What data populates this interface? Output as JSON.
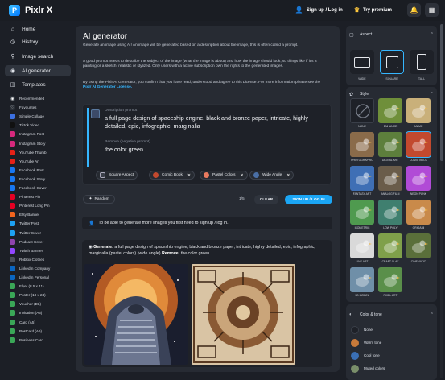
{
  "app": {
    "name": "Pixlr X"
  },
  "topbar": {
    "signup": "Sign up / Log in",
    "premium": "Try premium"
  },
  "sidebar": {
    "nav": [
      {
        "label": "Home",
        "icon": "home-icon"
      },
      {
        "label": "History",
        "icon": "history-icon"
      },
      {
        "label": "Image search",
        "icon": "search-icon"
      },
      {
        "label": "AI generator",
        "icon": "ai-icon"
      },
      {
        "label": "Templates",
        "icon": "templates-icon"
      }
    ],
    "templates": [
      {
        "label": "Recommended",
        "color": "#2a2f37"
      },
      {
        "label": "Favourites",
        "color": "#2a2f37"
      },
      {
        "label": "Simple Collage",
        "color": "#3b6fe0"
      },
      {
        "label": "Tiktok Video",
        "color": "#111111"
      },
      {
        "label": "Instagram Post",
        "color": "#d6297d"
      },
      {
        "label": "Instagram Story",
        "color": "#d6297d"
      },
      {
        "label": "YouTube Thumb",
        "color": "#e62117"
      },
      {
        "label": "YouTube Art",
        "color": "#e62117"
      },
      {
        "label": "Facebook Post",
        "color": "#1877f2"
      },
      {
        "label": "Facebook Story",
        "color": "#1877f2"
      },
      {
        "label": "Facebook Cover",
        "color": "#1877f2"
      },
      {
        "label": "Pinterest Pin",
        "color": "#e60023"
      },
      {
        "label": "Pinterest Long Pin",
        "color": "#e60023"
      },
      {
        "label": "Etsy Banner",
        "color": "#f1641e"
      },
      {
        "label": "Twitter Post",
        "color": "#1da1f2"
      },
      {
        "label": "Twitter Cover",
        "color": "#1da1f2"
      },
      {
        "label": "Podcast Cover",
        "color": "#8e44ad"
      },
      {
        "label": "Twitch Banner",
        "color": "#9146ff"
      },
      {
        "label": "Roblox Clothes",
        "color": "#4a4f59"
      },
      {
        "label": "LinkedIn Company",
        "color": "#0a66c2"
      },
      {
        "label": "LinkedIn Personal",
        "color": "#0a66c2"
      },
      {
        "label": "Flyer (8.5 x 11)",
        "color": "#3aa757"
      },
      {
        "label": "Poster (18 x 24)",
        "color": "#3aa757"
      },
      {
        "label": "Voucher (DL)",
        "color": "#3aa757"
      },
      {
        "label": "Invitation (A5)",
        "color": "#3aa757"
      },
      {
        "label": "Card (A5)",
        "color": "#3aa757"
      },
      {
        "label": "Postcard (A6)",
        "color": "#3aa757"
      },
      {
        "label": "Business Card",
        "color": "#3aa757"
      }
    ]
  },
  "main": {
    "title": "AI generator",
    "paragraphs": [
      "Generate an image using AI! An image will be generated based on a description about the image, this is often called a prompt.",
      "A good prompt needs to describe the subject of the image (what the image is about) and how the image should look, so things like if it's a painting or a sketch, realistic or stylized. Only users with a active subscription own the rights to the generated images.",
      "By using the Pixlr AI Generator, you confirm that you have read, understood and agree to this License. For more information please see the"
    ],
    "license_link": "Pixlr AI Generator License.",
    "prompt_label": "Description prompt",
    "prompt_text": "a full page design of spaceship engine, black and bronze paper, intricate, highly detailed, epic, infographic, marginalia",
    "negative_label": "Remove (negative prompt)",
    "negative_text": "the color green",
    "chips": [
      {
        "label": "Square Aspect",
        "color": "#3a3f49"
      },
      {
        "label": "Comic Book",
        "color": "#c2492e"
      },
      {
        "label": "Pastel Colors",
        "color": "#e87a5f"
      },
      {
        "label": "Wide Angle",
        "color": "#4a6fa5"
      }
    ],
    "random_label": "Random",
    "counter": "1/5",
    "clear_label": "CLEAR",
    "signup_label": "SIGN UP / LOG IN",
    "notice": "To be able to generate more images you first need to sign up / log in.",
    "generate_label": "Generate:",
    "generate_text": "a full page design of spaceship engine, black and bronze paper, intricate, highly detailed, epic, infographic, marginalia (pastel colors) (wide angle)",
    "remove_label": "Remove:",
    "remove_text": "the color green"
  },
  "rpanel": {
    "aspect_title": "Aspect",
    "aspects": [
      {
        "label": "WIDE",
        "selected": false
      },
      {
        "label": "SQUARE",
        "selected": true
      },
      {
        "label": "TALL",
        "selected": false
      }
    ],
    "style_title": "Style",
    "styles": [
      {
        "label": "NONE",
        "color": "#1e2128",
        "selected": false
      },
      {
        "label": "ENHANCE",
        "color": "#6f8f3a",
        "selected": false
      },
      {
        "label": "ANIME",
        "color": "#c9b07a",
        "selected": false
      },
      {
        "label": "PHOTOGRAPHIC",
        "color": "#8a6b4a",
        "selected": false
      },
      {
        "label": "DIGITAL ART",
        "color": "#5d7f3c",
        "selected": false
      },
      {
        "label": "COMIC BOOK",
        "color": "#c2492e",
        "selected": true
      },
      {
        "label": "FANTASY ART",
        "color": "#3f6fb5",
        "selected": false
      },
      {
        "label": "ANALOG FILM",
        "color": "#6a5c4a",
        "selected": false
      },
      {
        "label": "NEON PUNK",
        "color": "#b14bd6",
        "selected": false
      },
      {
        "label": "ISOMETRIC",
        "color": "#4f9a4f",
        "selected": false
      },
      {
        "label": "LOW POLY",
        "color": "#3f7f6f",
        "selected": false
      },
      {
        "label": "ORIGAMI",
        "color": "#c98a4a",
        "selected": false
      },
      {
        "label": "LINE ART",
        "color": "#d9d9d9",
        "selected": false
      },
      {
        "label": "CRAFT CLAY",
        "color": "#7fa04a",
        "selected": false
      },
      {
        "label": "CINEMATIC",
        "color": "#5a6f3a",
        "selected": false
      },
      {
        "label": "3D MODEL",
        "color": "#6f8fa8",
        "selected": false
      },
      {
        "label": "PIXEL ART",
        "color": "#5a8f4a",
        "selected": false
      }
    ],
    "color_title": "Color & tone",
    "colors": [
      {
        "label": "None",
        "color": "#1e2128"
      },
      {
        "label": "Warm tone",
        "color": "#c87a3a"
      },
      {
        "label": "Cool tone",
        "color": "#3a6fb5"
      },
      {
        "label": "Muted colors",
        "color": "#7a8f6a"
      }
    ]
  }
}
